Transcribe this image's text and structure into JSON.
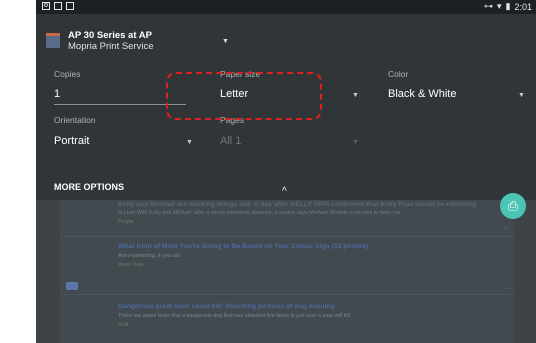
{
  "status_bar": {
    "time": "2:01",
    "left_icons": [
      "settings-icon",
      "notification-icon",
      "photo-icon"
    ],
    "right_icons": [
      "key-icon",
      "wifi-icon",
      "battery-icon"
    ]
  },
  "print_panel": {
    "printer_name": "AP 30 Series at AP",
    "printer_service": "Mopria Print Service",
    "fields": {
      "copies": {
        "label": "Copies",
        "value": "1"
      },
      "paper_size": {
        "label": "Paper size",
        "value": "Letter"
      },
      "color": {
        "label": "Color",
        "value": "Black & White"
      },
      "orientation": {
        "label": "Orientation",
        "value": "Portrait"
      },
      "pages": {
        "label": "Pages",
        "value": "All 1"
      }
    },
    "more_options": "MORE OPTIONS",
    "highlight_color": "#e02020",
    "fab_color": "#4cc4b6"
  },
  "feed": {
    "items": [
      {
        "title": "Kelly and Michael are working things out: A day after KELLY RIPA confirmed that Kelly Ripa would be returning",
        "desc": "to Live! With Kelly and Michael' after a nearly weeklong absence, a source says Michael Strahan is excited to have her",
        "source": "People"
      },
      {
        "title": "What Kind of Mom You're Going to Be Based on Your Zodiac Sign (12 photos)",
        "desc": "Astro-parenting, if you will.",
        "source": "Mirror Daily"
      },
      {
        "title": "Dangerous great dane could kill: Shocking pictures of dog mauling",
        "desc": "There are grave fears that a dangerous dog that has attacked five times in just over a year will kill.",
        "source": "Stuff"
      }
    ]
  }
}
